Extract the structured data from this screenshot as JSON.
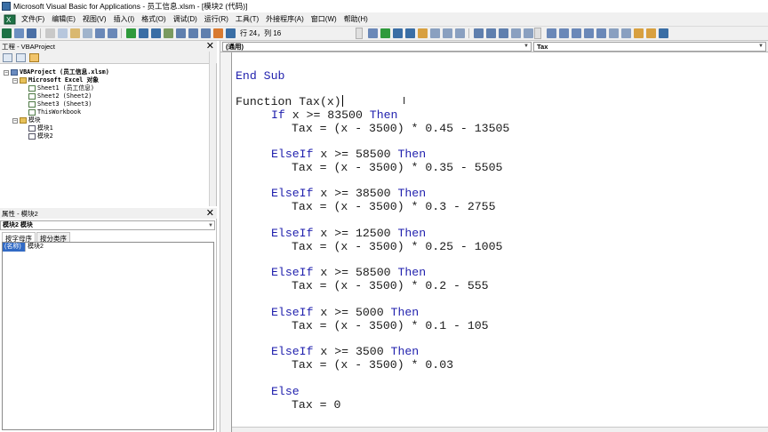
{
  "window": {
    "title": "Microsoft Visual Basic for Applications - 员工信息.xlsm - [模块2 (代码)]"
  },
  "menu": {
    "items": [
      "文件(F)",
      "编辑(E)",
      "视图(V)",
      "插入(I)",
      "格式(O)",
      "调试(D)",
      "运行(R)",
      "工具(T)",
      "外接程序(A)",
      "窗口(W)",
      "帮助(H)"
    ]
  },
  "toolbar": {
    "position": "行 24，列 16"
  },
  "project": {
    "header": "工程 - VBAProject",
    "tree": [
      "VBAProject (员工信息.xlsm)",
      "Microsoft Excel 对象",
      "Sheet1 (员工信息)",
      "Sheet2 (Sheet2)",
      "Sheet3 (Sheet3)",
      "ThisWorkbook",
      "模块",
      "模块1",
      "模块2"
    ]
  },
  "properties": {
    "header": "属性 - 模块2",
    "object": "模块2 模块",
    "tabs": [
      "按字母序",
      "按分类序"
    ],
    "rows": [
      {
        "key": "(名称)",
        "value": "模块2"
      }
    ]
  },
  "editor": {
    "object_combo": "(通用)",
    "proc_combo": "Tax",
    "lines": [
      {
        "kw": "End Sub",
        "rest": ""
      },
      {
        "kw": "",
        "rest": ""
      },
      {
        "kw": "",
        "rest": "Function Tax(x)"
      },
      {
        "kw": "If",
        "rest": " x >= 83500 ",
        "kw2": "Then"
      },
      {
        "kw": "",
        "rest": "Tax = (x - 3500) * 0.45 - 13505"
      },
      {
        "kw": "ElseIf",
        "rest": " x >= 58500 ",
        "kw2": "Then"
      },
      {
        "kw": "",
        "rest": "Tax = (x - 3500) * 0.35 - 5505"
      },
      {
        "kw": "ElseIf",
        "rest": " x >= 38500 ",
        "kw2": "Then"
      },
      {
        "kw": "",
        "rest": "Tax = (x - 3500) * 0.3 - 2755"
      },
      {
        "kw": "ElseIf",
        "rest": " x >= 12500 ",
        "kw2": "Then"
      },
      {
        "kw": "",
        "rest": "Tax = (x - 3500) * 0.25 - 1005"
      },
      {
        "kw": "ElseIf",
        "rest": " x >= 58500 ",
        "kw2": "Then"
      },
      {
        "kw": "",
        "rest": "Tax = (x - 3500) * 0.2 - 555"
      },
      {
        "kw": "ElseIf",
        "rest": " x >= 5000 ",
        "kw2": "Then"
      },
      {
        "kw": "",
        "rest": "Tax = (x - 3500) * 0.1 - 105"
      },
      {
        "kw": "ElseIf",
        "rest": " x >= 3500 ",
        "kw2": "Then"
      },
      {
        "kw": "",
        "rest": "Tax = (x - 3500) * 0.03"
      },
      {
        "kw": "Else",
        "rest": ""
      },
      {
        "kw": "",
        "rest": "Tax = 0"
      }
    ]
  },
  "colors": {
    "keyword": "#1f1fad",
    "selection": "#316ac5",
    "chrome": "#f0f0f0"
  }
}
